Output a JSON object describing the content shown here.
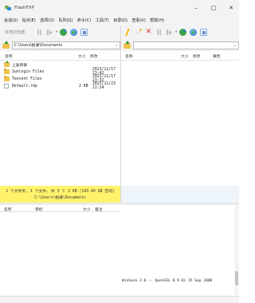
{
  "window": {
    "title": "FlashFXP"
  },
  "menu": [
    "会话(S)",
    "站点(E)",
    "选项(O)",
    "队列(Q)",
    "命令(C)",
    "工具(T)",
    "目录(D)",
    "查看(V)",
    "帮助(H)"
  ],
  "left_toolbar": {
    "site_label": "本地浏览器"
  },
  "left_path": "C:\\Users\\柏谦\\Documents",
  "right_path": "",
  "left_columns": {
    "name": "名称",
    "size": "大小",
    "date": "修改"
  },
  "right_columns": {
    "name": "名称",
    "size": "大小",
    "date": "修改",
    "attr": "属性"
  },
  "left_files": [
    {
      "name": "上层目录",
      "size": "",
      "date": "",
      "icon": "up-folder-icon"
    },
    {
      "name": "Sunlogin Files",
      "size": "",
      "date": "2023/11/17 23:42",
      "icon": "folder-icon"
    },
    {
      "name": "Tencent Files",
      "size": "",
      "date": "2023/11/17 23:32",
      "icon": "folder-icon"
    },
    {
      "name": "Default.rdp",
      "size": "2 KB",
      "date": "2023/11/23 11:24",
      "icon": "file-icon"
    }
  ],
  "left_status": {
    "line1": "2 个文件夹, 1 个文件, 共 3 个 2 KB (143.49 GB 空闲)",
    "line2": "C:\\Users\\柏谦\\Documents"
  },
  "queue_columns": {
    "name": "名称",
    "target": "目标",
    "size": "大小",
    "note": "备注"
  },
  "log_text": "WinSock 2.0 -- OpenSSL 0.9.8i 15 Sep 2008",
  "accent_colors": {
    "status_yellow": "#fff36c",
    "status_blue": "#eef5fb"
  }
}
